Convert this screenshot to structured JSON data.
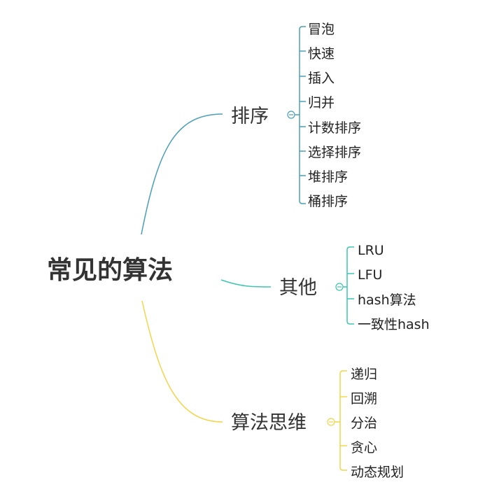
{
  "root": {
    "title": "常见的算法"
  },
  "branches": [
    {
      "title": "排序",
      "color": "#4a9fb5",
      "leaves": [
        "冒泡",
        "快速",
        "插入",
        "归并",
        "计数排序",
        "选择排序",
        "堆排序",
        "桶排序"
      ]
    },
    {
      "title": "其他",
      "color": "#3cc6b0",
      "leaves": [
        "LRU",
        "LFU",
        "hash算法",
        "一致性hash"
      ]
    },
    {
      "title": "算法思维",
      "color": "#f2d54a",
      "leaves": [
        "递归",
        "回溯",
        "分治",
        "贪心",
        "动态规划"
      ]
    }
  ]
}
